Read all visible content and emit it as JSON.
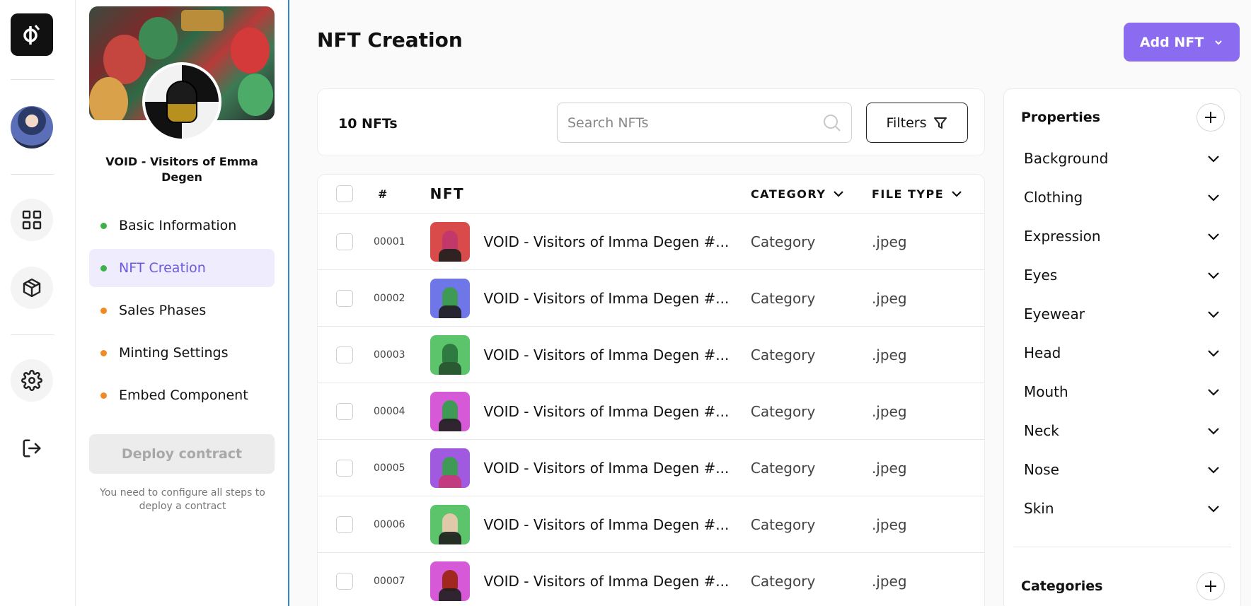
{
  "rail": {
    "logo_icon": "phi-logo-icon",
    "items": [
      "dashboard-grid-icon",
      "cube-icon",
      "gear-icon",
      "logout-icon"
    ]
  },
  "project": {
    "name": "VOID - Visitors of Emma Degen",
    "nav": [
      {
        "label": "Basic Information",
        "status_color": "#3db24b",
        "active": false
      },
      {
        "label": "NFT Creation",
        "status_color": "#3db24b",
        "active": true
      },
      {
        "label": "Sales Phases",
        "status_color": "#f08a24",
        "active": false
      },
      {
        "label": "Minting Settings",
        "status_color": "#f08a24",
        "active": false
      },
      {
        "label": "Embed Component",
        "status_color": "#f08a24",
        "active": false
      }
    ],
    "deploy_label": "Deploy contract",
    "deploy_note": "You need to configure all steps to deploy a contract"
  },
  "main": {
    "title": "NFT Creation",
    "add_button": "Add NFT",
    "count": "10 NFTs",
    "search_placeholder": "Search NFTs",
    "filters_label": "Filters",
    "columns": {
      "num": "#",
      "nft": "NFT",
      "category": "CATEGORY",
      "file_type": "FILE TYPE"
    },
    "rows": [
      {
        "num": "00001",
        "name": "VOID - Visitors of Imma Degen #...",
        "category": "Category",
        "file_type": ".jpeg",
        "color": "#d94a4a"
      },
      {
        "num": "00002",
        "name": "VOID - Visitors of Imma Degen #...",
        "category": "Category",
        "file_type": ".jpeg",
        "color": "#6e76e8"
      },
      {
        "num": "00003",
        "name": "VOID - Visitors of Imma Degen #...",
        "category": "Category",
        "file_type": ".jpeg",
        "color": "#5cc46a"
      },
      {
        "num": "00004",
        "name": "VOID - Visitors of Imma Degen #...",
        "category": "Category",
        "file_type": ".jpeg",
        "color": "#d65ad8"
      },
      {
        "num": "00005",
        "name": "VOID - Visitors of Imma Degen #...",
        "category": "Category",
        "file_type": ".jpeg",
        "color": "#a05ae0"
      },
      {
        "num": "00006",
        "name": "VOID - Visitors of Imma Degen #...",
        "category": "Category",
        "file_type": ".jpeg",
        "color": "#5cc46a"
      },
      {
        "num": "00007",
        "name": "VOID - Visitors of Imma Degen #...",
        "category": "Category",
        "file_type": ".jpeg",
        "color": "#d65ad8"
      }
    ]
  },
  "properties": {
    "title": "Properties",
    "items": [
      "Background",
      "Clothing",
      "Expression",
      "Eyes",
      "Eyewear",
      "Head",
      "Mouth",
      "Neck",
      "Nose",
      "Skin"
    ],
    "categories_title": "Categories"
  }
}
